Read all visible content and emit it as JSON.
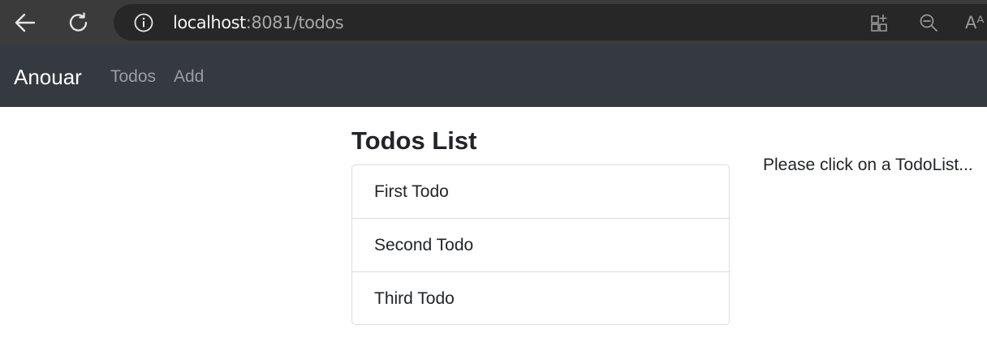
{
  "browser": {
    "url_host": "localhost",
    "url_rest": ":8081/todos",
    "icons": [
      "back-arrow-icon",
      "reload-icon",
      "info-icon",
      "apps-icon",
      "zoom-out-icon",
      "read-aloud-icon"
    ],
    "read_aloud_glyph": "Aᴬ"
  },
  "navbar": {
    "brand": "Anouar",
    "links": [
      {
        "label": "Todos"
      },
      {
        "label": "Add"
      }
    ]
  },
  "main": {
    "title": "Todos List",
    "todos": [
      {
        "title": "First Todo"
      },
      {
        "title": "Second Todo"
      },
      {
        "title": "Third Todo"
      }
    ],
    "hint": "Please click on a TodoList..."
  },
  "colors": {
    "browser_bar": "#3b3b3b",
    "address_bar": "#272727",
    "navbar": "#343a40",
    "nav_link": "#9a9da2",
    "text": "#212529",
    "border": "#dcdcdc"
  }
}
